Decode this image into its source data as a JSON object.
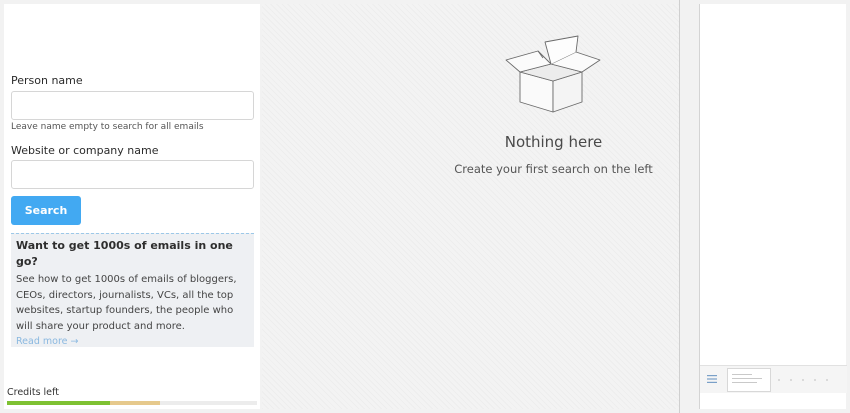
{
  "form": {
    "person_label": "Person name",
    "person_value": "",
    "person_placeholder": "",
    "hint": "Leave name empty to search for all emails",
    "website_label": "Website or company name",
    "website_value": "",
    "website_placeholder": "",
    "search_label": "Search"
  },
  "promo": {
    "title": "Want to get 1000s of emails in one go?",
    "body": "See how to get 1000s of emails of bloggers, CEOs, directors, journalists, VCs, all the top websites, startup founders, the people who will share your product and more.",
    "link": "Read more →"
  },
  "credits": {
    "label": "Credits left",
    "used_fraction": 0.41,
    "extra_fraction": 0.2,
    "colors": {
      "used": "#7ec132",
      "extra": "#e6c98c",
      "track": "#ececec"
    }
  },
  "empty_state": {
    "icon": "open-box-icon",
    "title": "Nothing here",
    "subtitle": "Create your first search on the left"
  },
  "right_panel": {
    "icons": [
      "menu-icon",
      "page-thumbnail"
    ]
  },
  "colors": {
    "accent": "#42a9f2",
    "link": "#8ab8e0",
    "promo_background": "#eef0f3"
  }
}
